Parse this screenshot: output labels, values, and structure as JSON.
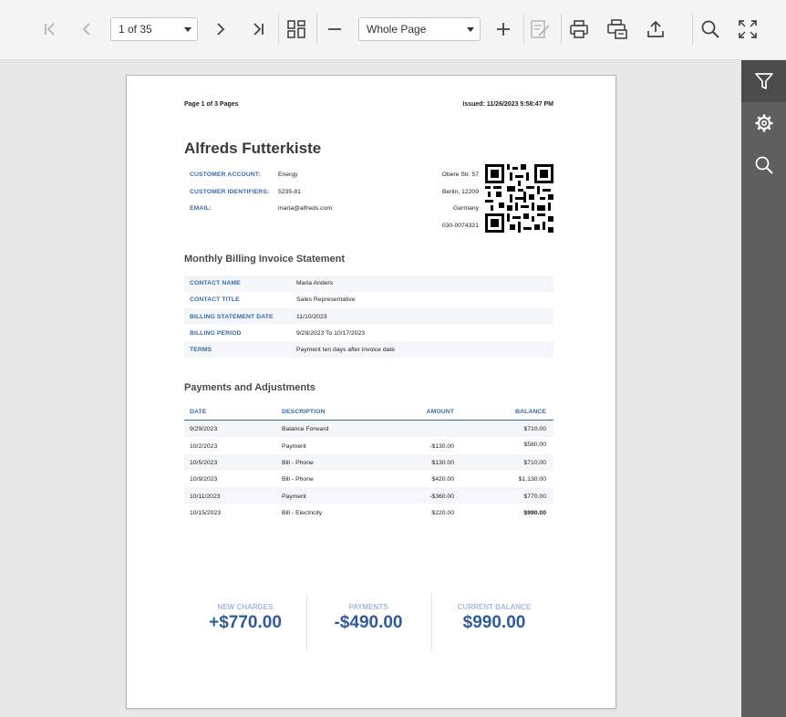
{
  "toolbar": {
    "page_selector_value": "1 of 35",
    "zoom_value": "Whole Page"
  },
  "report": {
    "page_info": "Page 1 of 3 Pages",
    "issued": "Issued: 11/26/2023 5:58:47 PM",
    "company_name": "Alfreds Futterkiste",
    "customer": [
      {
        "label": "CUSTOMER ACCOUNT:",
        "value": "Energy"
      },
      {
        "label": "CUSTOMER IDENTIFIERS:",
        "value": "5235-81"
      },
      {
        "label": "EMAIL:",
        "value": "maria@alfreds.com"
      }
    ],
    "address": [
      "Obere Str. 57",
      "Berlin,  12209",
      "Germany",
      "030-0074321"
    ],
    "statement_title": "Monthly Billing Invoice Statement",
    "statement": [
      {
        "label": "CONTACT NAME",
        "value": "Maria Anders"
      },
      {
        "label": "CONTACT TITLE",
        "value": "Sales Representative"
      },
      {
        "label": "BILLING STATEMENT DATE",
        "value": "11/10/2023"
      },
      {
        "label": "BILLING PERIOD",
        "value": "9/28/2023 To 10/17/2023"
      },
      {
        "label": "TERMS",
        "value": "Payment ten days after invoice date"
      }
    ],
    "payments_title": "Payments and Adjustments",
    "payments_columns": [
      "DATE",
      "DESCRIPTION",
      "AMOUNT",
      "BALANCE"
    ],
    "payments_rows": [
      {
        "date": "9/29/2023",
        "description": "Balance Forward",
        "amount": "",
        "balance": "$710.00"
      },
      {
        "date": "10/2/2023",
        "description": "Payment",
        "amount": "-$130.00",
        "balance": "$580.00"
      },
      {
        "date": "10/5/2023",
        "description": "Bill - Phone",
        "amount": "$130.00",
        "balance": "$710.00"
      },
      {
        "date": "10/9/2023",
        "description": "Bill - Phone",
        "amount": "$420.00",
        "balance": "$1,130.00"
      },
      {
        "date": "10/11/2023",
        "description": "Payment",
        "amount": "-$360.00",
        "balance": "$770.00"
      },
      {
        "date": "10/15/2023",
        "description": "Bill - Electricity",
        "amount": "$220.00",
        "balance": "$990.00"
      }
    ],
    "summary": [
      {
        "label": "NEW CHARGES",
        "value": "+$770.00"
      },
      {
        "label": "PAYMENTS",
        "value": "-$490.00"
      },
      {
        "label": "CURRENT BALANCE",
        "value": "$990.00"
      }
    ]
  },
  "icons": {
    "first_page": "first-page-icon",
    "prev_page": "previous-page-icon",
    "next_page": "next-page-icon",
    "last_page": "last-page-icon",
    "multipage": "multipage-icon",
    "zoom_out": "zoom-out-icon",
    "zoom_in": "zoom-in-icon",
    "editing": "editing-fields-icon",
    "print": "print-icon",
    "print_page": "print-page-icon",
    "export": "export-icon",
    "search": "search-icon",
    "fullscreen": "fullscreen-icon",
    "filter": "filter-icon",
    "settings": "gear-icon",
    "side_search": "search-icon"
  },
  "colors": {
    "accent_blue": "#3a6aa8",
    "summary_value": "#2f5b98",
    "side_panel": "#5f5f5f"
  }
}
